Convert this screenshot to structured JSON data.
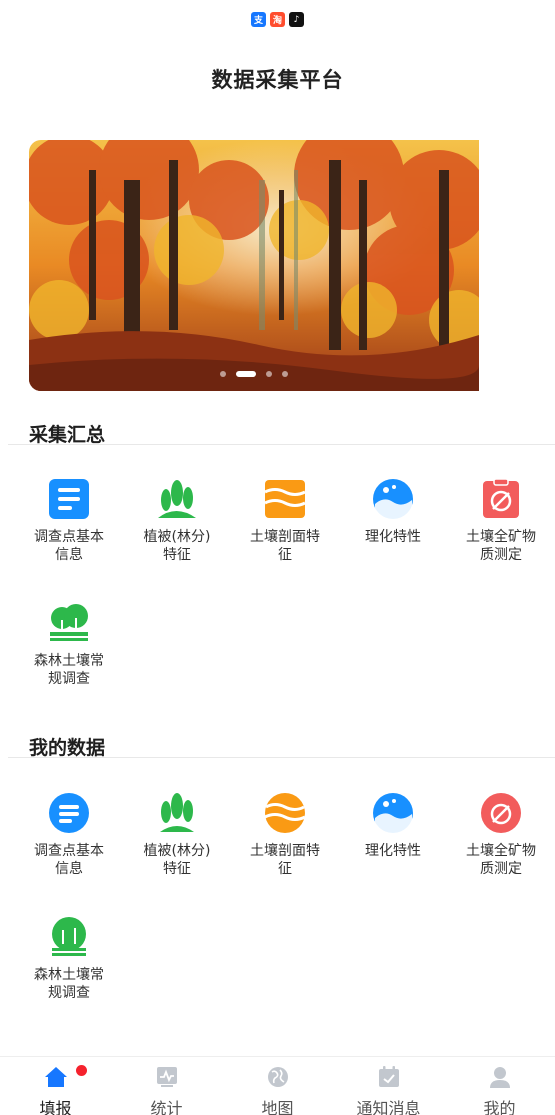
{
  "status_apps": [
    {
      "icon": "alipay-icon",
      "glyph": "支",
      "color": "#1677ff"
    },
    {
      "icon": "taobao-icon",
      "glyph": "淘",
      "color": "#ff4d2e"
    },
    {
      "icon": "douyin-icon",
      "glyph": "♪",
      "color": "#111111"
    }
  ],
  "header": {
    "title": "数据采集平台"
  },
  "banner": {
    "slides": 4,
    "active_index": 1
  },
  "collect_section": {
    "title": "采集汇总",
    "items": [
      {
        "label": "调查点基本信息",
        "icon": "document-list-icon"
      },
      {
        "label": "植被(林分)特征",
        "icon": "vegetation-leaves-icon"
      },
      {
        "label": "土壤剖面特征",
        "icon": "soil-layers-icon"
      },
      {
        "label": "理化特性",
        "icon": "water-drop-icon"
      },
      {
        "label": "土壤全矿物质测定",
        "icon": "mineral-test-icon"
      },
      {
        "label": "森林土壤常规调查",
        "icon": "forest-soil-icon"
      }
    ]
  },
  "my_data_section": {
    "title": "我的数据",
    "items": [
      {
        "label": "调查点基本信息",
        "icon": "document-list-icon"
      },
      {
        "label": "植被(林分)特征",
        "icon": "vegetation-leaves-icon"
      },
      {
        "label": "土壤剖面特征",
        "icon": "soil-layers-icon"
      },
      {
        "label": "理化特性",
        "icon": "water-drop-icon"
      },
      {
        "label": "土壤全矿物质测定",
        "icon": "mineral-test-icon"
      },
      {
        "label": "森林土壤常规调查",
        "icon": "forest-soil-icon"
      }
    ]
  },
  "tabbar": {
    "items": [
      {
        "label": "填报",
        "icon": "home-icon",
        "active": true,
        "badge": true
      },
      {
        "label": "统计",
        "icon": "chart-icon"
      },
      {
        "label": "地图",
        "icon": "globe-icon"
      },
      {
        "label": "通知消息",
        "icon": "calendar-check-icon"
      },
      {
        "label": "我的",
        "icon": "user-icon"
      }
    ]
  },
  "colors": {
    "blue": "#1890ff",
    "green": "#2db84b",
    "orange": "#fa9a14",
    "red": "#f25c5c",
    "active_tab": "#1677ff"
  }
}
